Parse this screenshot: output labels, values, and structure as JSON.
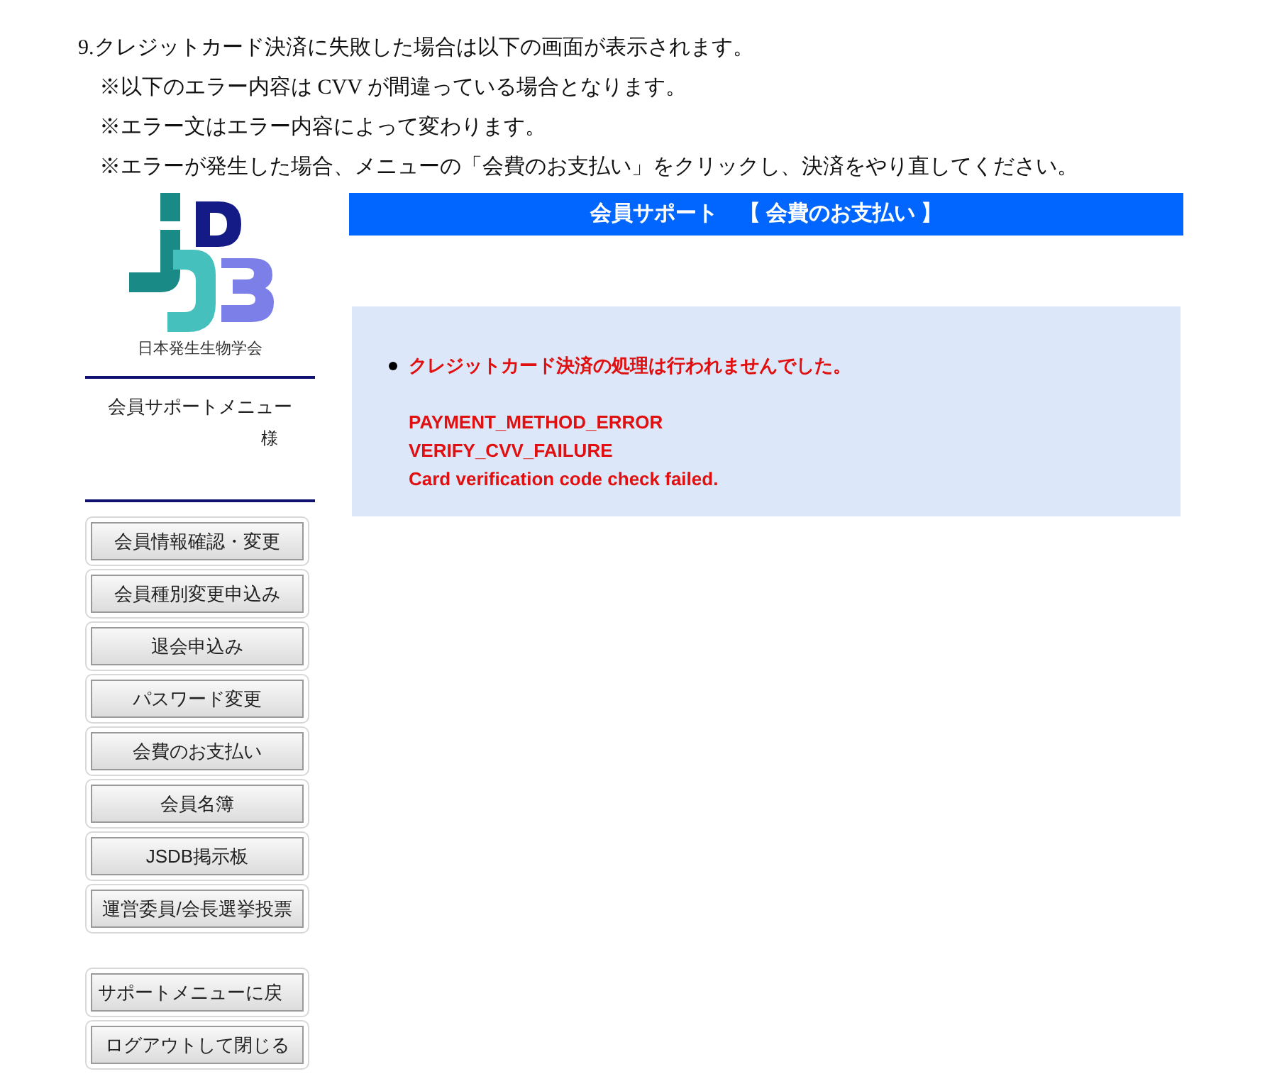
{
  "instructions": {
    "heading": "9.クレジットカード決済に失敗した場合は以下の画面が表示されます。",
    "notes": [
      "※以下のエラー内容は CVV が間違っている場合となります。",
      "※エラー文はエラー内容によって変わります。",
      "※エラーが発生した場合、メニューの「会費のお支払い」をクリックし、決済をやり直してください。"
    ]
  },
  "sidebar": {
    "logo_caption": "日本発生生物学会",
    "menu_title": "会員サポートメニュー",
    "user_suffix": "様",
    "menu_buttons": [
      "会員情報確認・変更",
      "会員種別変更申込み",
      "退会申込み",
      "パスワード変更",
      "会費のお支払い",
      "会員名簿",
      "JSDB掲示板",
      "運営委員/会長選挙投票"
    ],
    "footer_buttons": [
      "サポートメニューに戻",
      "ログアウトして閉じる"
    ]
  },
  "main": {
    "title": "会員サポート　【 会費のお支払い 】",
    "error": {
      "message": "クレジットカード決済の処理は行われませんでした。",
      "details": [
        "PAYMENT_METHOD_ERROR",
        "VERIFY_CVV_FAILURE",
        "Card verification code check failed."
      ]
    }
  }
}
